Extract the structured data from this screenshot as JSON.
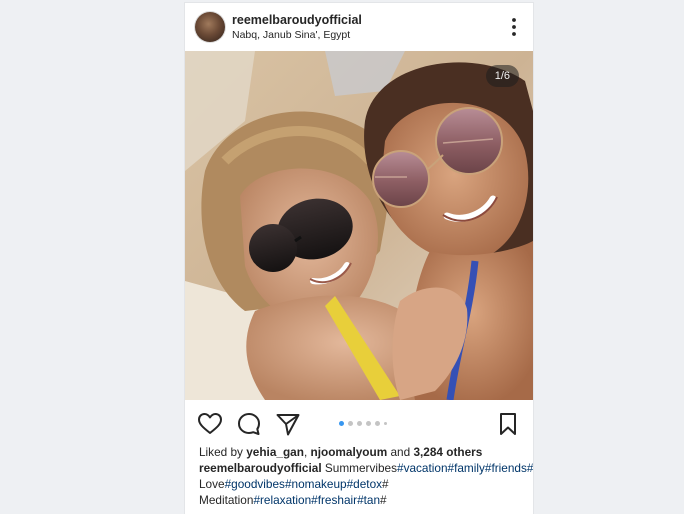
{
  "post": {
    "username": "reemelbaroudyofficial",
    "location": "Nabq, Janub Sina', Egypt",
    "icons": {
      "more": "more-options-icon",
      "like": "heart-icon",
      "comment": "comment-bubble-icon",
      "share": "paper-plane-icon",
      "save": "bookmark-icon"
    },
    "carousel": {
      "counter": "1/6",
      "active_dot_color": "#3897f0",
      "inactive_dot_color": "#c4c4c4"
    }
  },
  "likes": {
    "prefix": "Liked by",
    "user1": "yehia_gan",
    "separator": ",",
    "user2": "njoomalyoum",
    "and": "and",
    "others": "3,284 others"
  },
  "caption": {
    "username": "reemelbaroudyofficial",
    "line1": [
      {
        "text": "Summervibes",
        "tag": false
      },
      {
        "text": "#vacation",
        "tag": true
      },
      {
        "text": "#family",
        "tag": true
      },
      {
        "text": "#friends",
        "tag": true
      },
      {
        "text": "#",
        "tag": true
      }
    ],
    "line2": [
      {
        "text": "Love",
        "tag": false
      },
      {
        "text": "#goodvibes",
        "tag": true
      },
      {
        "text": "#nomakeup",
        "tag": true
      },
      {
        "text": "#detox",
        "tag": true
      },
      {
        "text": "#",
        "tag": false
      }
    ],
    "line3": [
      {
        "text": "Meditation",
        "tag": false
      },
      {
        "text": "#relaxation",
        "tag": true
      },
      {
        "text": "#freshair",
        "tag": true
      },
      {
        "text": "#tan",
        "tag": true
      },
      {
        "text": "#",
        "tag": false
      }
    ]
  },
  "colors": {
    "text": "#262626",
    "hashtag": "#003569"
  }
}
